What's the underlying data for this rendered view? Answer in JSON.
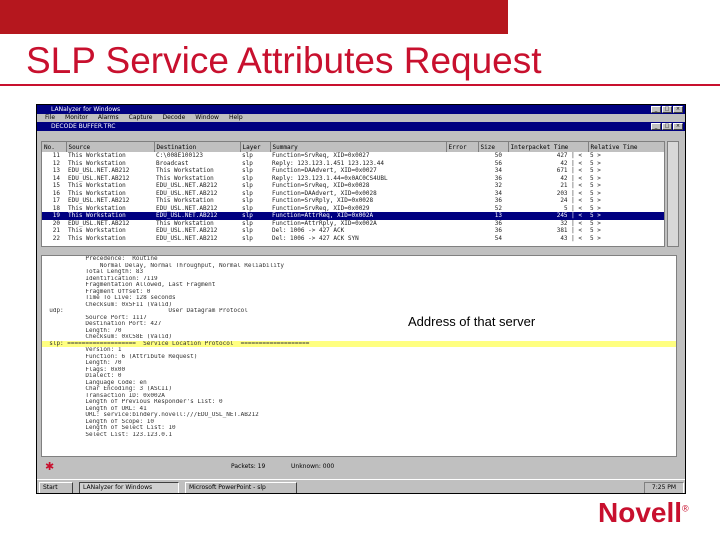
{
  "slide": {
    "title": "SLP Service Attributes Request",
    "annotation": "Address of that server",
    "logo_text": "Novell",
    "logo_mark": "®",
    "colors": {
      "brand_red": "#c8102e",
      "band_red": "#b5171e",
      "selection": "#000080"
    }
  },
  "app": {
    "title": "LANalyzer for Windows",
    "menu": [
      "File",
      "Monitor",
      "Alarms",
      "Capture",
      "Decode",
      "Window",
      "Help"
    ],
    "mdi_title": "DECODE BUFFER.TRC"
  },
  "summary": {
    "columns": [
      "No.",
      "Source",
      "Destination",
      "Layer",
      "Summary",
      "Error",
      "Size",
      "Interpacket Time",
      "Relative Time"
    ],
    "rows": [
      [
        "11",
        "This Workstation",
        "C:\\008E100123",
        "slp",
        "Function=SrvReq, XID=0x0027",
        "",
        "50",
        "427 | <",
        "5 >"
      ],
      [
        "12",
        "This Workstation",
        "Broadcast",
        "slp",
        "Reply: 123.123.1.451 123.123.44",
        "",
        "56",
        "42 | <",
        "5 >"
      ],
      [
        "13",
        "EDU_USL.NET.AB212",
        "This Workstation",
        "slp",
        "Function=DAAdvert, XID=0x0027",
        "",
        "34",
        "671 | <",
        "5 >"
      ],
      [
        "14",
        "EDU_USL.NET.AB212",
        "This Workstation",
        "slp",
        "Reply: 123.123.1.44=0x0AC0CS4UBL",
        "",
        "36",
        "42 | <",
        "5 >"
      ],
      [
        "15",
        "This Workstation",
        "EDU_USL.NET.AB212",
        "slp",
        "Function=SrvReq, XID=0x0028",
        "",
        "32",
        "21 | <",
        "5 >"
      ],
      [
        "16",
        "This Workstation",
        "EDU_USL.NET.AB212",
        "slp",
        "Function=DAAdvert, XID=0x0028",
        "",
        "34",
        "203 | <",
        "5 >"
      ],
      [
        "17",
        "EDU_USL.NET.AB212",
        "This Workstation",
        "slp",
        "Function=SrvRply, XID=0x0028",
        "",
        "36",
        "24 | <",
        "5 >"
      ],
      [
        "18",
        "This Workstation",
        "EDU_USL.NET.AB212",
        "slp",
        "Function=SrvReq, XID=0x0029",
        "",
        "52",
        "5 | <",
        "5 >"
      ],
      [
        "19",
        "This Workstation",
        "EDU_USL.NET.AB212",
        "slp",
        "Function=AttrReq, XID=0x002A",
        "",
        "13",
        "245 | <",
        "5 >"
      ],
      [
        "20",
        "EDU_USL.NET.AB212",
        "This Workstation",
        "slp",
        "Function=AttrRply, XID=0x002A",
        "",
        "36",
        "32 | <",
        "5 >"
      ],
      [
        "21",
        "This Workstation",
        "EDU_USL.NET.AB212",
        "slp",
        "Del: 1006 -> 427 ACK",
        "",
        "36",
        "381 | <",
        "5 >"
      ],
      [
        "22",
        "This Workstation",
        "EDU_USL.NET.AB212",
        "slp",
        "Del: 1006 -> 427 ACK SYN",
        "",
        "54",
        "43 | <",
        "5 >"
      ]
    ],
    "selected_row": 8
  },
  "detail": {
    "lines": [
      "            Precedence:  Routine",
      "                Normal Delay, Normal Throughput, Normal Reliability",
      "            Total Length: 83",
      "            Identification: 7119",
      "            Fragmentation Allowed, Last Fragment",
      "            Fragment Offset: 0",
      "            Time To Live: 128 seconds",
      "            Checksum: 0x5F11 (Valid)",
      "  udp:                             User Datagram Protocol",
      "            Source Port: 1117",
      "            Destination Port: 427",
      "            Length: 70",
      "            Checksum: 0xC58E (Valid)",
      "  slp: ===================  Service Location Protocol  ===================",
      "            Version: 1",
      "            Function: 6 (Attribute Request)",
      "            Length: 70",
      "            Flags: 0x00",
      "            Dialect: 0",
      "            Language Code: en",
      "            Char Encoding: 3 (ASCII)",
      "            Transaction ID: 0x002A",
      "            Length of Previous Responder's List: 0",
      "            Length of URL: 41",
      "            URL: service:bindery.novell:///EDU_USL_NET.AB212",
      "            Length of Scope: 10",
      "            Length of Select List: 10",
      "            Select List: 123.123.0.1"
    ],
    "highlight_line": 13
  },
  "status": {
    "packets_label": "Packets: 19",
    "unknown_label": "Unknown: 000"
  },
  "taskbar": {
    "start_label": "Start",
    "tasks": [
      "LANalyzer for Windows",
      "Microsoft PowerPoint - slp"
    ],
    "clock": "7:25 PM"
  }
}
